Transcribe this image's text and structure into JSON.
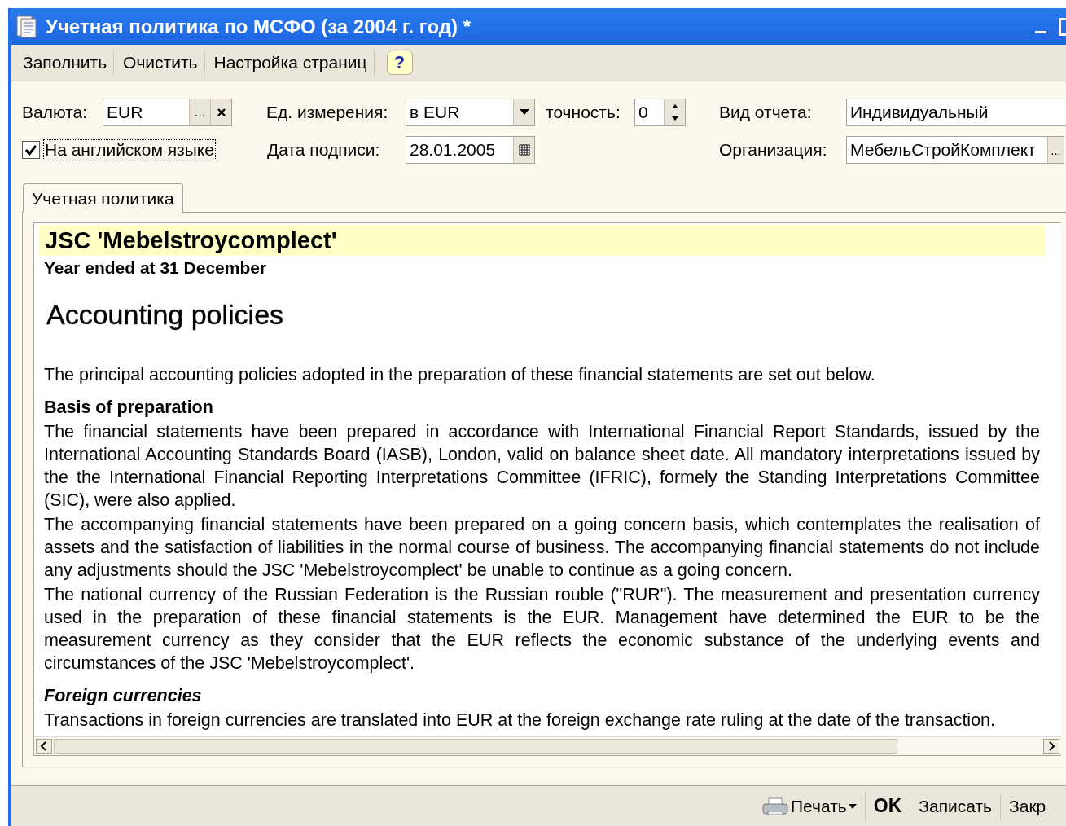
{
  "window": {
    "title": "Учетная политика по МСФО (за 2004 г. год) *"
  },
  "toolbar": {
    "buttons": [
      "Заполнить",
      "Очистить",
      "Настройка страниц"
    ],
    "help": "?"
  },
  "form": {
    "currency": {
      "label": "Валюта:",
      "value": "EUR",
      "choose": "..."
    },
    "units": {
      "label": "Ед. измерения:",
      "value": "в EUR"
    },
    "precision": {
      "label": "точность:",
      "value": "0"
    },
    "report_type": {
      "label": "Вид отчета:",
      "value": "Индивидуальный"
    },
    "english": {
      "label": "На английском языке",
      "checked": true
    },
    "sign_date": {
      "label": "Дата подписи:",
      "value": "28.01.2005"
    },
    "organization": {
      "label": "Организация:",
      "value": "МебельСтройКомплект",
      "choose": "..."
    }
  },
  "tabs": [
    {
      "label": "Учетная политика",
      "selected": true
    }
  ],
  "document": [
    {
      "kind": "company",
      "text": "JSC 'Mebelstroycomplect'"
    },
    {
      "kind": "subtitle",
      "text": "Year ended at 31 December"
    },
    {
      "kind": "title",
      "text": "Accounting policies"
    },
    {
      "kind": "intro",
      "text": "The principal accounting policies adopted in the preparation of these financial statements are set out below."
    },
    {
      "kind": "heading",
      "text": "Basis of preparation"
    },
    {
      "kind": "para",
      "text": "The financial statements have been prepared in accordance with International Financial Report Standards, issued by the International Accounting Standards Board (IASB), London, valid on balance sheet date. All mandatory interpretations issued by the the International Financial Reporting Interpretations Committee (IFRIC), formely the Standing Interpretations Committee (SIC), were also applied."
    },
    {
      "kind": "para",
      "text": "The accompanying financial statements have been prepared on a going concern basis, which contemplates the realisation of assets and the satisfaction of liabilities in the normal course of business. The accompanying financial statements do not include any adjustments should the JSC 'Mebelstroycomplect' be unable to continue as a going concern."
    },
    {
      "kind": "para",
      "text": "The national currency of the Russian Federation is the Russian rouble (\"RUR\"). The measurement and presentation currency used in the preparation of these financial statements is the EUR. Management have determined the EUR to be the measurement currency as they consider that the EUR reflects the economic substance of the underlying events and circumstances of the JSC 'Mebelstroycomplect'."
    },
    {
      "kind": "subheading",
      "text": "Foreign currencies"
    },
    {
      "kind": "para",
      "text": "Transactions in foreign currencies are translated into EUR at the foreign exchange rate ruling at the date of the transaction."
    }
  ],
  "footer": [
    {
      "kind": "print",
      "label": "Печать"
    },
    {
      "kind": "default",
      "label": "OK"
    },
    {
      "kind": "plain",
      "label": "Записать"
    },
    {
      "kind": "plain",
      "label": "Закр"
    }
  ]
}
